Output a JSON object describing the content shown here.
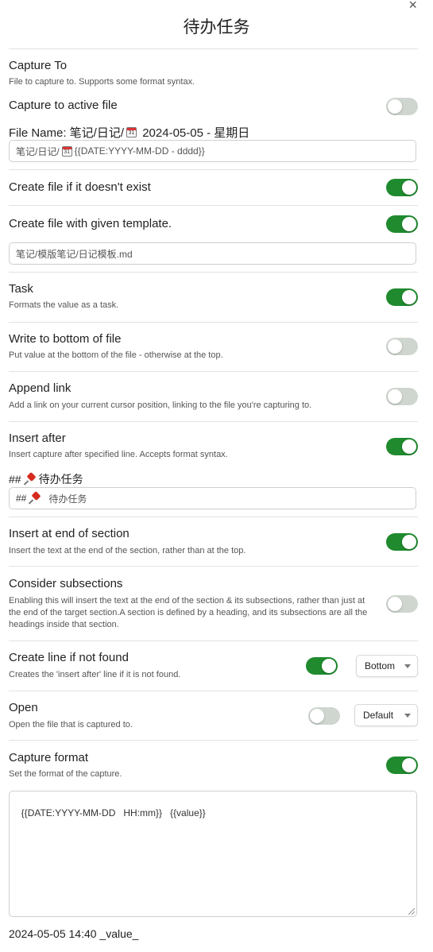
{
  "modal": {
    "title": "待办任务",
    "close_symbol": "×"
  },
  "capture_to": {
    "label": "Capture To",
    "desc": "File to capture to. Supports some format syntax."
  },
  "active_file": {
    "label": "Capture to active file",
    "enabled": false
  },
  "file_name": {
    "label_prefix": "File Name: 笔记/日记/",
    "label_suffix": " 2024-05-05 - 星期日",
    "input_prefix": "笔记/日记/",
    "input_suffix": " {{DATE:YYYY-MM-DD - dddd}}",
    "calendar_day": "31"
  },
  "create_if_missing": {
    "label": "Create file if it doesn't exist",
    "enabled": true
  },
  "create_with_template": {
    "label": "Create file with given template.",
    "enabled": true,
    "template_value": "笔记/模版笔记/日记模板.md"
  },
  "task": {
    "label": "Task",
    "desc": "Formats the value as a task.",
    "enabled": true
  },
  "write_bottom": {
    "label": "Write to bottom of file",
    "desc": "Put value at the bottom of the file - otherwise at the top.",
    "enabled": false
  },
  "append_link": {
    "label": "Append link",
    "desc": "Add a link on your current cursor position, linking to the file you're capturing to.",
    "enabled": false
  },
  "insert_after": {
    "label": "Insert after",
    "desc": "Insert capture after specified line. Accepts format syntax.",
    "enabled": true,
    "preview_prefix": "##",
    "preview_text": "待办任务",
    "input_prefix": "##",
    "input_text": "待办任务"
  },
  "insert_end_section": {
    "label": "Insert at end of section",
    "desc": "Insert the text at the end of the section, rather than at the top.",
    "enabled": true
  },
  "consider_subsections": {
    "label": "Consider subsections",
    "desc": "Enabling this will insert the text at the end of the section & its subsections, rather than just at the end of the target section.A section is defined by a heading, and its subsections are all the headings inside that section.",
    "enabled": false
  },
  "create_line": {
    "label": "Create line if not found",
    "desc": "Creates the 'insert after' line if it is not found.",
    "enabled": true,
    "dropdown_value": "Bottom"
  },
  "open": {
    "label": "Open",
    "desc": "Open the file that is captured to.",
    "enabled": false,
    "dropdown_value": "Default"
  },
  "capture_format": {
    "label": "Capture format",
    "desc": "Set the format of the capture.",
    "enabled": true,
    "value": "{{DATE:YYYY-MM-DD   HH:mm}}   {{value}}"
  },
  "format_preview": "2024-05-05 14:40 _value_",
  "colors": {
    "toggle_on": "#1f8a2e",
    "toggle_off": "#cfd6cf"
  }
}
